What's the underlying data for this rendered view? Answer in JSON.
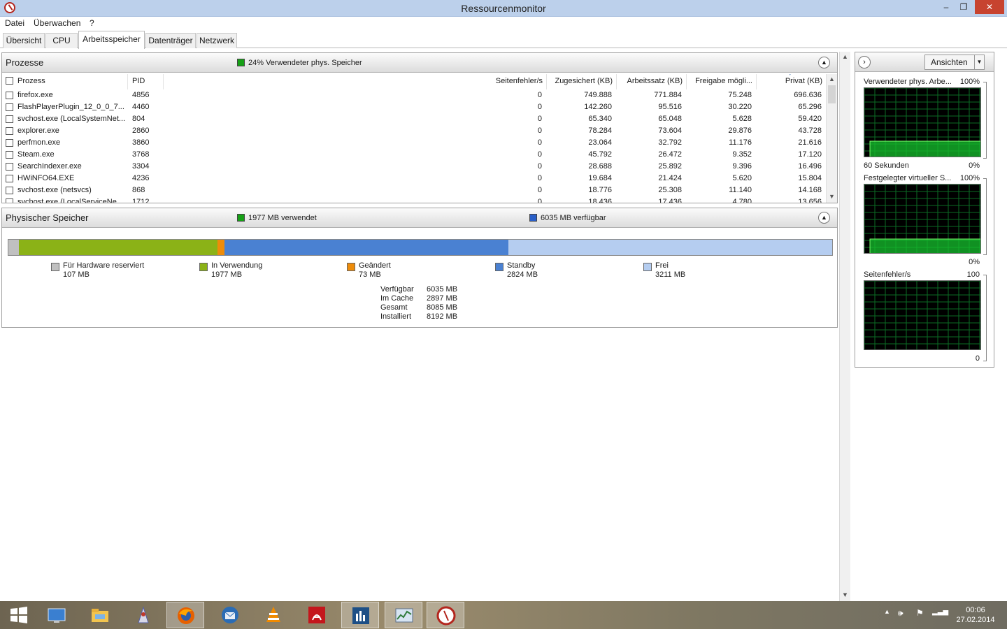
{
  "window": {
    "title": "Ressourcenmonitor",
    "min": "–",
    "max": "❐",
    "close": "✕"
  },
  "menu": [
    "Datei",
    "Überwachen",
    "?"
  ],
  "tabs": [
    "Übersicht",
    "CPU",
    "Arbeitsspeicher",
    "Datenträger",
    "Netzwerk"
  ],
  "processes": {
    "title": "Prozesse",
    "info": "24% Verwendeter phys. Speicher",
    "info_color": "#16a016",
    "columns": [
      "Prozess",
      "PID",
      "Seitenfehler/s",
      "Zugesichert (KB)",
      "Arbeitssatz (KB)",
      "Freigabe mögli...",
      "Privat (KB)"
    ],
    "rows": [
      [
        "firefox.exe",
        "4856",
        "0",
        "749.888",
        "771.884",
        "75.248",
        "696.636"
      ],
      [
        "FlashPlayerPlugin_12_0_0_7...",
        "4460",
        "0",
        "142.260",
        "95.516",
        "30.220",
        "65.296"
      ],
      [
        "svchost.exe (LocalSystemNet...",
        "804",
        "0",
        "65.340",
        "65.048",
        "5.628",
        "59.420"
      ],
      [
        "explorer.exe",
        "2860",
        "0",
        "78.284",
        "73.604",
        "29.876",
        "43.728"
      ],
      [
        "perfmon.exe",
        "3860",
        "0",
        "23.064",
        "32.792",
        "11.176",
        "21.616"
      ],
      [
        "Steam.exe",
        "3768",
        "0",
        "45.792",
        "26.472",
        "9.352",
        "17.120"
      ],
      [
        "SearchIndexer.exe",
        "3304",
        "0",
        "28.688",
        "25.892",
        "9.396",
        "16.496"
      ],
      [
        "HWiNFO64.EXE",
        "4236",
        "0",
        "19.684",
        "21.424",
        "5.620",
        "15.804"
      ],
      [
        "svchost.exe (netsvcs)",
        "868",
        "0",
        "18.776",
        "25.308",
        "11.140",
        "14.168"
      ],
      [
        "svchost.exe (LocalServiceNe...",
        "1712",
        "0",
        "18.436",
        "17.436",
        "4.780",
        "13.656"
      ]
    ]
  },
  "physical": {
    "title": "Physischer Speicher",
    "used_label": "1977 MB verwendet",
    "used_color": "#16a016",
    "avail_label": "6035 MB verfügbar",
    "avail_color": "#2a5fc8",
    "segments": [
      {
        "name": "Für Hardware reserviert",
        "value": "107 MB",
        "mb": 107,
        "color": "#c0c0c0"
      },
      {
        "name": "In Verwendung",
        "value": "1977 MB",
        "mb": 1977,
        "color": "#8bb217"
      },
      {
        "name": "Geändert",
        "value": "73 MB",
        "mb": 73,
        "color": "#ee8c0a"
      },
      {
        "name": "Standby",
        "value": "2824 MB",
        "mb": 2824,
        "color": "#4a81d2"
      },
      {
        "name": "Frei",
        "value": "3211 MB",
        "mb": 3211,
        "color": "#b5cdf0"
      }
    ],
    "stats": [
      {
        "k": "Verfügbar",
        "v": "6035 MB"
      },
      {
        "k": "Im Cache",
        "v": "2897 MB"
      },
      {
        "k": "Gesamt",
        "v": "8085 MB"
      },
      {
        "k": "Installiert",
        "v": "8192 MB"
      }
    ]
  },
  "graphs": {
    "view_label": "Ansichten",
    "items": [
      {
        "title": "Verwendeter phys. Arbe...",
        "max": "100%",
        "min": "0%",
        "sub": "60 Sekunden",
        "level": 0.24
      },
      {
        "title": "Festgelegter virtueller S...",
        "max": "100%",
        "min": "0%",
        "sub": "",
        "level": 0.22
      },
      {
        "title": "Seitenfehler/s",
        "max": "100",
        "min": "0",
        "sub": "",
        "level": 0
      }
    ]
  },
  "taskbar": {
    "icons": [
      "windows-start-icon",
      "desktop-icon",
      "file-explorer-icon",
      "app-icon",
      "firefox-icon",
      "thunderbird-icon",
      "vlc-icon",
      "acrobat-icon",
      "hwinfo-icon",
      "perfmon-icon",
      "resource-monitor-icon"
    ],
    "time": "00:06",
    "date": "27.02.2014"
  }
}
